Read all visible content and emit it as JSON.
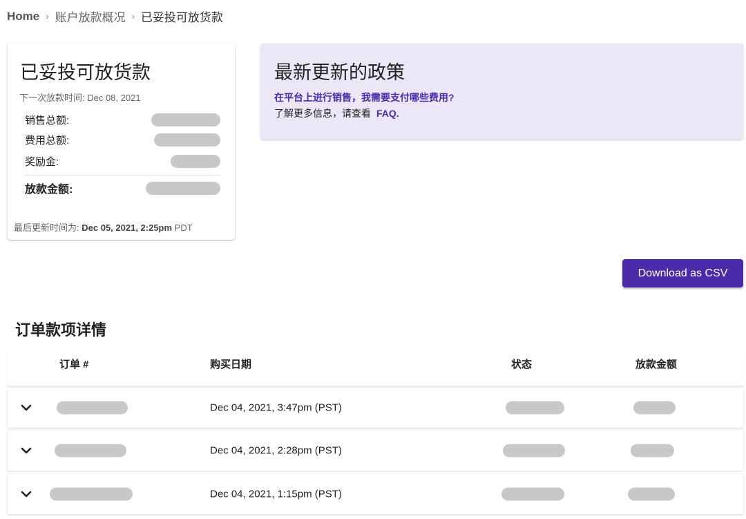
{
  "breadcrumb": {
    "home": "Home",
    "parent": "账户放款概况",
    "current": "已妥投可放货款",
    "separator": "›"
  },
  "summary": {
    "title": "已妥投可放货款",
    "next_payout": "下一次放款时间: Dec 08, 2021",
    "rows": [
      {
        "label": "销售总额:"
      },
      {
        "label": "费用总额:"
      },
      {
        "label": "奖励金:"
      }
    ],
    "total_label": "放款金额:",
    "updated_prefix": "最后更新时间为:",
    "updated_time": "Dec 05, 2021, 2:25pm",
    "updated_tz": "PDT"
  },
  "policy": {
    "title": "最新更新的政策",
    "question": "在平台上进行销售，我需要支付哪些费用?",
    "more_prefix": "了解更多信息，请查看",
    "faq": "FAQ."
  },
  "download_button": "Download as CSV",
  "orders": {
    "title": "订单款项详情",
    "columns": [
      "订单 #",
      "购买日期",
      "状态",
      "放款金额"
    ],
    "rows": [
      {
        "date": "Dec 04, 2021, 3:47pm (PST)"
      },
      {
        "date": "Dec 04, 2021, 2:28pm (PST)"
      },
      {
        "date": "Dec 04, 2021, 1:15pm (PST)"
      }
    ]
  },
  "colors": {
    "accent": "#4b2ba8",
    "policy_bg": "#ebe7f6",
    "redacted": "#c8c8c8"
  },
  "icons": {
    "row_expand": "chevron-down-icon",
    "breadcrumb_separator": "chevron-right-icon"
  }
}
